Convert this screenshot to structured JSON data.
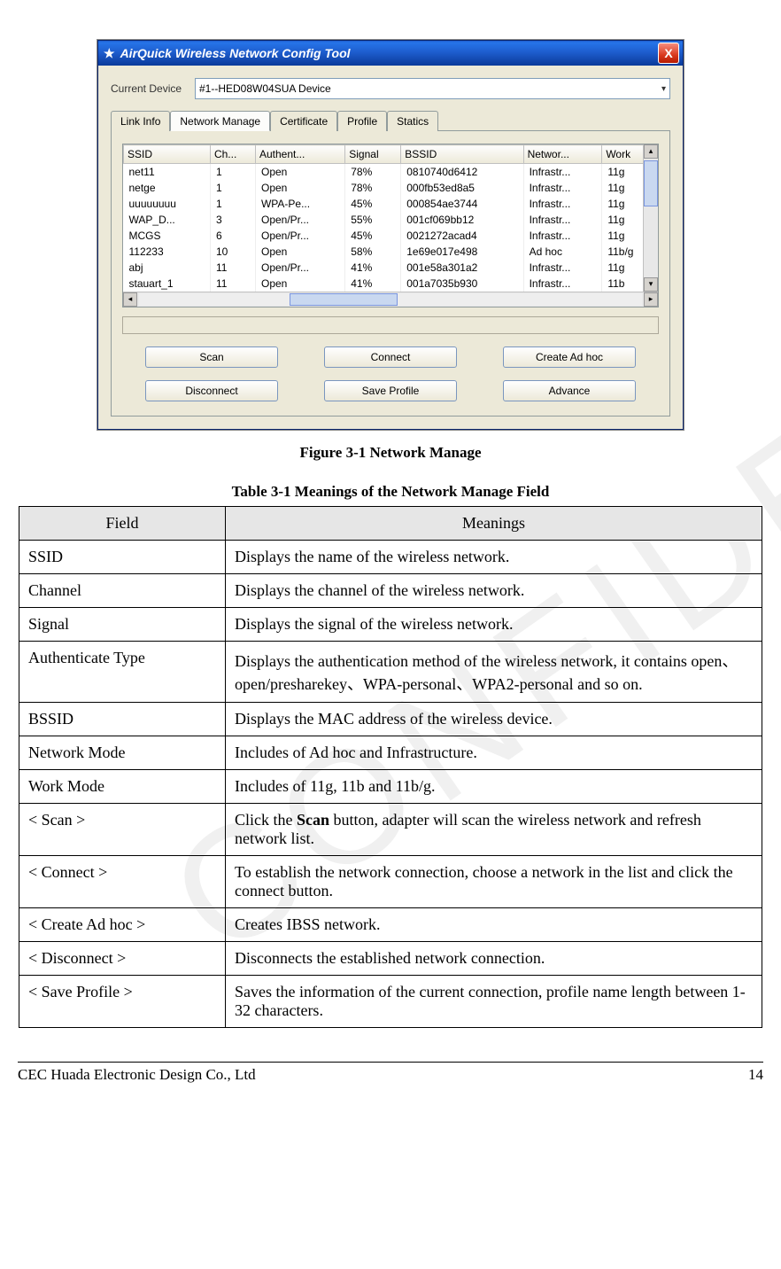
{
  "watermark": "CONFIDENTIAL",
  "window": {
    "title": "AirQuick Wireless Network Config Tool",
    "close_label": "X",
    "device_label": "Current Device",
    "device_value": "#1--HED08W04SUA Device",
    "tabs": [
      "Link Info",
      "Network Manage",
      "Certificate",
      "Profile",
      "Statics"
    ],
    "active_tab_index": 1,
    "columns": [
      "SSID",
      "Ch...",
      "Authent...",
      "Signal",
      "BSSID",
      "Networ...",
      "Work"
    ],
    "rows": [
      {
        "ssid": "net11",
        "ch": "1",
        "auth": "Open",
        "signal": "78%",
        "bssid": "0810740d6412",
        "net": "Infrastr...",
        "work": "11g"
      },
      {
        "ssid": "netge",
        "ch": "1",
        "auth": "Open",
        "signal": "78%",
        "bssid": "000fb53ed8a5",
        "net": "Infrastr...",
        "work": "11g"
      },
      {
        "ssid": "uuuuuuuu",
        "ch": "1",
        "auth": "WPA-Pe...",
        "signal": "45%",
        "bssid": "000854ae3744",
        "net": "Infrastr...",
        "work": "11g"
      },
      {
        "ssid": "WAP_D...",
        "ch": "3",
        "auth": "Open/Pr...",
        "signal": "55%",
        "bssid": "001cf069bb12",
        "net": "Infrastr...",
        "work": "11g"
      },
      {
        "ssid": "MCGS",
        "ch": "6",
        "auth": "Open/Pr...",
        "signal": "45%",
        "bssid": "0021272acad4",
        "net": "Infrastr...",
        "work": "11g"
      },
      {
        "ssid": "112233",
        "ch": "10",
        "auth": "Open",
        "signal": "58%",
        "bssid": "1e69e017e498",
        "net": "Ad hoc",
        "work": "11b/g"
      },
      {
        "ssid": "abj",
        "ch": "11",
        "auth": "Open/Pr...",
        "signal": "41%",
        "bssid": "001e58a301a2",
        "net": "Infrastr...",
        "work": "11g"
      },
      {
        "ssid": "stauart_1",
        "ch": "11",
        "auth": "Open",
        "signal": "41%",
        "bssid": "001a7035b930",
        "net": "Infrastr...",
        "work": "11b"
      }
    ],
    "buttons_row1": [
      "Scan",
      "Connect",
      "Create Ad hoc"
    ],
    "buttons_row2": [
      "Disconnect",
      "Save Profile",
      "Advance"
    ]
  },
  "figure_caption": "Figure 3-1 Network Manage",
  "table_caption": "Table 3-1 Meanings of the Network Manage Field",
  "doc_table": {
    "headers": [
      "Field",
      "Meanings"
    ],
    "rows": [
      {
        "field": "SSID",
        "meaning": "Displays the name of the wireless network."
      },
      {
        "field": "Channel",
        "meaning": "Displays the channel of the wireless network."
      },
      {
        "field": "Signal",
        "meaning": "Displays the signal of the wireless network."
      },
      {
        "field": "Authenticate Type",
        "meaning": "Displays the authentication method of the wireless network, it contains open、open/presharekey、WPA-personal、WPA2-personal and so on."
      },
      {
        "field": "BSSID",
        "meaning": "Displays the MAC address of the wireless device."
      },
      {
        "field": "Network Mode",
        "meaning": "Includes of Ad hoc and Infrastructure."
      },
      {
        "field": "Work Mode",
        "meaning": "Includes of 11g, 11b and 11b/g."
      },
      {
        "field": "< Scan >",
        "meaning_html": "Click the <b>Scan</b> button, adapter will scan the wireless network and refresh network list."
      },
      {
        "field": "< Connect >",
        "meaning": "To establish the network connection, choose a network in the list and click the connect button."
      },
      {
        "field": "< Create Ad hoc >",
        "meaning": "Creates IBSS network."
      },
      {
        "field": "< Disconnect >",
        "meaning": "Disconnects the established network connection."
      },
      {
        "field": "< Save Profile >",
        "meaning": "Saves the information of the current connection, profile name length between 1-32 characters."
      }
    ]
  },
  "footer": {
    "left": "CEC Huada Electronic Design Co., Ltd",
    "right": "14"
  }
}
